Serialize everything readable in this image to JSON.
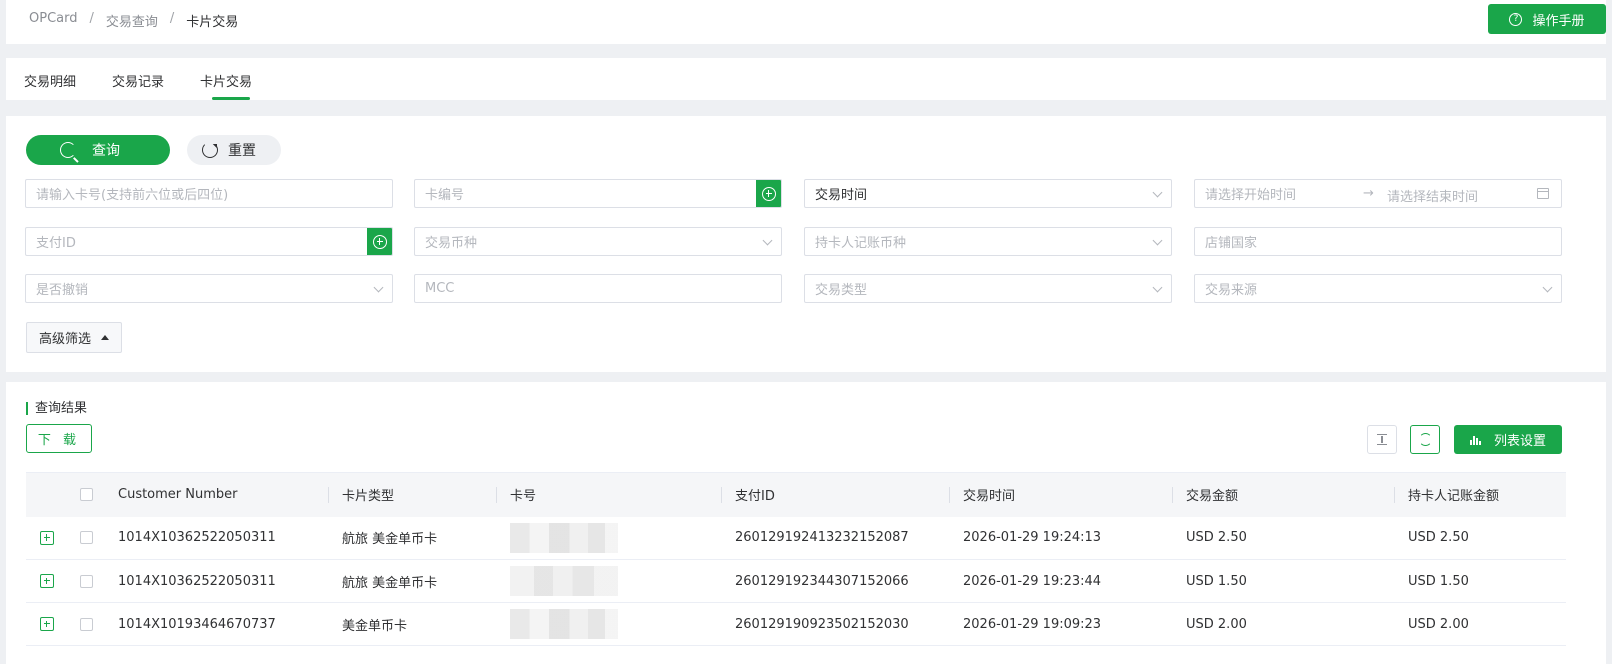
{
  "breadcrumb": [
    "OPCard",
    "交易查询",
    "卡片交易"
  ],
  "header": {
    "manual_label": "操作手册"
  },
  "tabs": [
    {
      "label": "交易明细",
      "active": false
    },
    {
      "label": "交易记录",
      "active": false
    },
    {
      "label": "卡片交易",
      "active": true
    }
  ],
  "filters": {
    "query_label": "查询",
    "reset_label": "重置",
    "card_number_placeholder": "请输入卡号(支持前六位或后四位)",
    "card_id_placeholder": "卡编号",
    "time_type_value": "交易时间",
    "start_time_placeholder": "请选择开始时间",
    "end_time_placeholder": "请选择结束时间",
    "payment_id_placeholder": "支付ID",
    "txn_currency_placeholder": "交易币种",
    "holder_currency_placeholder": "持卡人记账币种",
    "merchant_country_placeholder": "店铺国家",
    "revoked_placeholder": "是否撤销",
    "mcc_placeholder": "MCC",
    "txn_type_placeholder": "交易类型",
    "txn_source_placeholder": "交易来源",
    "advanced_label": "高级筛选"
  },
  "results": {
    "title": "查询结果",
    "download_label": "下 载",
    "column_settings_label": "列表设置",
    "columns": [
      "Customer Number",
      "卡片类型",
      "卡号",
      "支付ID",
      "交易时间",
      "交易金额",
      "持卡人记账金额"
    ],
    "rows": [
      {
        "customer_number": "1014X10362522050311",
        "card_type": "航旅 美金单币卡",
        "payment_id": "260129192413232152087",
        "time": "2026-01-29 19:24:13",
        "amount": "USD 2.50",
        "holder_amount": "USD 2.50"
      },
      {
        "customer_number": "1014X10362522050311",
        "card_type": "航旅 美金单币卡",
        "payment_id": "260129192344307152066",
        "time": "2026-01-29 19:23:44",
        "amount": "USD 1.50",
        "holder_amount": "USD 1.50"
      },
      {
        "customer_number": "1014X10193464670737",
        "card_type": "美金单币卡",
        "payment_id": "260129190923502152030",
        "time": "2026-01-29 19:09:23",
        "amount": "USD 2.00",
        "holder_amount": "USD 2.00"
      }
    ]
  },
  "colors": {
    "accent": "#1aa64a",
    "page_bg": "#eef0f3"
  },
  "icons": [
    "help-icon",
    "refresh-icon",
    "plus-circle-icon",
    "chevron-down-icon",
    "calendar-icon",
    "caret-up-icon",
    "collapse-icon",
    "sync-icon",
    "bar-chart-icon",
    "checkbox-icon",
    "expand-icon"
  ]
}
